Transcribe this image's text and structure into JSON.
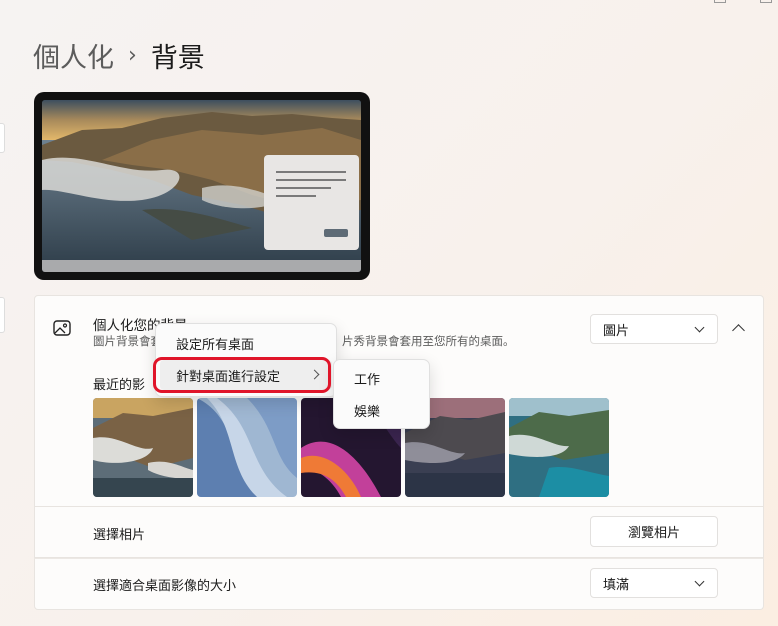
{
  "breadcrumb": {
    "parent": "個人化",
    "separator": "›",
    "current": "背景"
  },
  "background_card": {
    "title": "個人化您的背景",
    "description_left": "圖片背景會套",
    "description_right": "片秀背景會套用至您所有的桌面。",
    "type_dropdown": {
      "selected": "圖片"
    }
  },
  "recent": {
    "label": "最近的影",
    "thumbnails": [
      {
        "name": "big-sur-coast-thumbnail",
        "icon": "coastal-mountains-image"
      },
      {
        "name": "windows-bloom-blue-thumbnail",
        "icon": "blue-ribbon-image"
      },
      {
        "name": "windows-bloom-purple-thumbnail",
        "icon": "purple-ribbon-image"
      },
      {
        "name": "big-sur-dusk-thumbnail",
        "icon": "dusk-coast-image"
      },
      {
        "name": "big-sur-day-thumbnail",
        "icon": "teal-coast-image"
      }
    ]
  },
  "choose_photo": {
    "label": "選擇相片",
    "button": "瀏覽相片"
  },
  "fit": {
    "label": "選擇適合桌面影像的大小",
    "selected": "填滿"
  },
  "context_menu": {
    "items": [
      {
        "label": "設定所有桌面"
      },
      {
        "label": "針對桌面進行設定",
        "has_submenu": true
      }
    ]
  },
  "submenu": {
    "items": [
      {
        "label": "工作"
      },
      {
        "label": "娛樂"
      }
    ]
  },
  "colors": {
    "highlight_outline": "#e0152a",
    "accent": "#005fb8"
  }
}
